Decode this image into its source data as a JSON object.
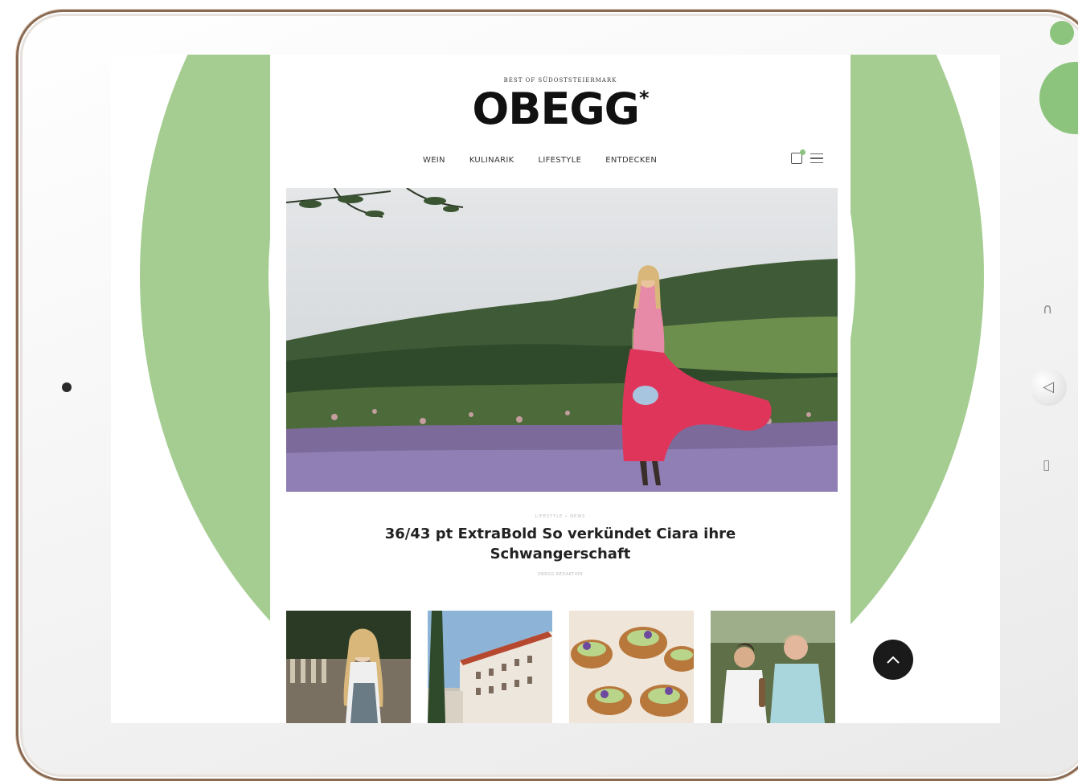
{
  "site": {
    "tagline": "BEST OF SÜDOSTSTEIERMARK",
    "logo": "OBEGG",
    "logo_mark": "*"
  },
  "nav": {
    "items": [
      "WEIN",
      "KULINARIK",
      "LIFESTYLE",
      "ENTDECKEN"
    ]
  },
  "article": {
    "kicker": "LIFESTYLE • NEWS",
    "headline": "36/43 pt ExtraBold So verkündet Ciara ihre Schwangerschaft",
    "byline": "OBEGG REDAKTION"
  },
  "thumbnails": [
    {
      "label": "woman-in-dirndl"
    },
    {
      "label": "castle-building"
    },
    {
      "label": "food-tartlets"
    },
    {
      "label": "two-men-chefs"
    }
  ],
  "colors": {
    "accent_green": "#a5cd92",
    "dot_green": "#8cc47d",
    "frame_bronze": "#8a6a52"
  },
  "icons": {
    "side_top": "headphones-icon",
    "side_middle": "back-icon",
    "side_bottom": "document-icon",
    "bag": "shopping-bag-icon",
    "menu": "menu-icon",
    "scroll": "chevron-up-icon"
  }
}
